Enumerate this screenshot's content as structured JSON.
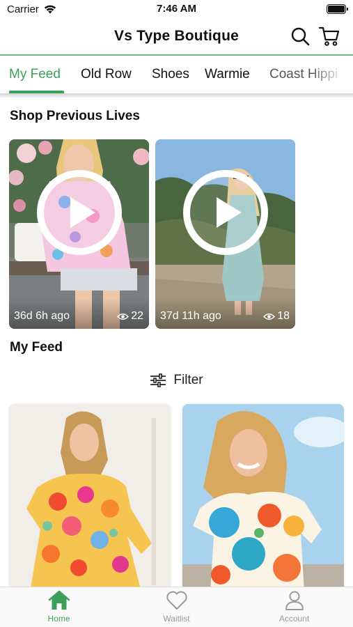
{
  "status_bar": {
    "carrier": "Carrier",
    "time": "7:46 AM"
  },
  "header": {
    "title": "Vs Type Boutique",
    "icons": [
      "search-icon",
      "cart-icon"
    ]
  },
  "tabs": [
    {
      "label": "My Feed",
      "active": true
    },
    {
      "label": "Old Row",
      "active": false
    },
    {
      "label": "Shoes",
      "active": false
    },
    {
      "label": "Warmie",
      "active": false
    },
    {
      "label": "Coast Hippi",
      "active": false
    }
  ],
  "previous_lives": {
    "title": "Shop Previous Lives",
    "items": [
      {
        "ago": "36d 6h ago",
        "views": "22"
      },
      {
        "ago": "37d 11h ago",
        "views": "18"
      }
    ]
  },
  "feed": {
    "title": "My Feed",
    "filter_label": "Filter"
  },
  "bottom_tabs": [
    {
      "label": "Home",
      "icon": "home-icon",
      "active": true
    },
    {
      "label": "Waitlist",
      "icon": "heart-icon",
      "active": false
    },
    {
      "label": "Account",
      "icon": "user-icon",
      "active": false
    }
  ],
  "colors": {
    "accent": "#3da05a",
    "header_rule": "#6fba83"
  }
}
